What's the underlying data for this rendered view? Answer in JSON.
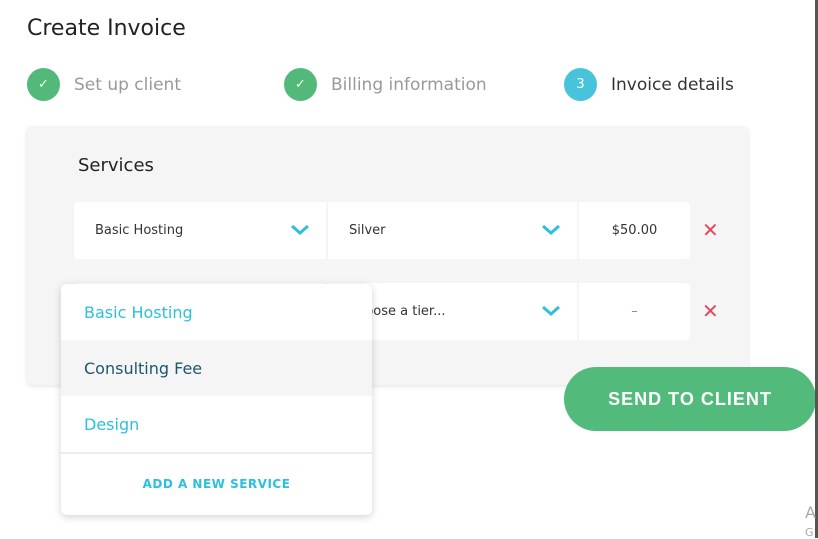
{
  "page": {
    "title": "Create Invoice"
  },
  "steps": [
    {
      "label": "Set up client",
      "state": "done",
      "icon": "check-icon"
    },
    {
      "label": "Billing information",
      "state": "done",
      "icon": "check-icon"
    },
    {
      "number": "3",
      "label": "Invoice details",
      "state": "current"
    }
  ],
  "services": {
    "heading": "Services",
    "rows": [
      {
        "service": "Basic Hosting",
        "tier": "Silver",
        "price": "$50.00"
      },
      {
        "service": "",
        "tier": "Choose a tier...",
        "tier_visible": "oose a tier...",
        "price": "–"
      }
    ]
  },
  "dropdown": {
    "options": [
      "Basic Hosting",
      "Consulting Fee",
      "Design"
    ],
    "highlighted": "Consulting Fee",
    "add_label": "ADD A NEW SERVICE"
  },
  "send_label": "SEND TO CLIENT",
  "watermark": {
    "line1": "A",
    "line2": "G"
  },
  "colors": {
    "success": "#52bb7b",
    "accent": "#2cc0dc",
    "danger": "#e04a5c"
  }
}
